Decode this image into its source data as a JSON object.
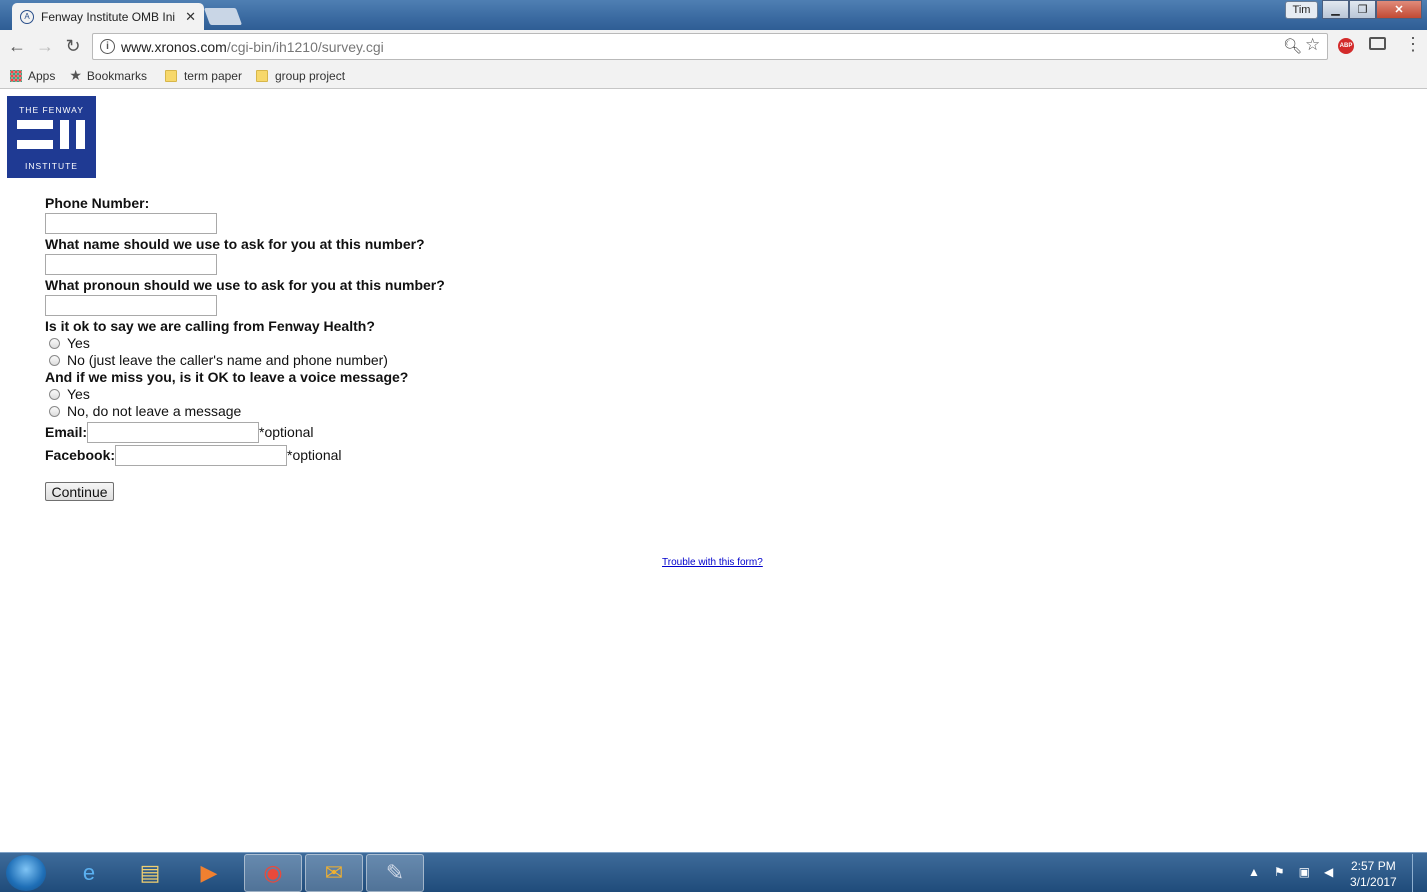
{
  "browser": {
    "tab_title": "Fenway Institute OMB Ini",
    "profile_name": "Tim",
    "url_host": "www.xronos.com",
    "url_path": "/cgi-bin/ih1210/survey.cgi",
    "bookmarks": [
      {
        "label": "Apps",
        "icon": "apps-grid-icon"
      },
      {
        "label": "Bookmarks",
        "icon": "star-icon"
      },
      {
        "label": "term paper",
        "icon": "folder-icon"
      },
      {
        "label": "group project",
        "icon": "folder-icon"
      }
    ]
  },
  "logo": {
    "line1": "THE FENWAY",
    "line2": "INSTITUTE",
    "color": "#1f3a93"
  },
  "form": {
    "phone_label": "Phone Number:",
    "name_label": "What name should we use to ask for you at this number?",
    "pronoun_label": "What pronoun should we use to ask for you at this number?",
    "fenway_label": "Is it ok to say we are calling from Fenway Health?",
    "fenway_yes": "Yes",
    "fenway_no": "No (just leave the caller's name and phone number)",
    "voicemail_label": "And if we miss you, is it OK to leave a voice message?",
    "voicemail_yes": "Yes",
    "voicemail_no": "No, do not leave a message",
    "email_label": "Email:",
    "email_note": "*optional",
    "facebook_label": "Facebook:",
    "facebook_note": "*optional",
    "continue_label": "Continue",
    "trouble_link": "Trouble with this form?"
  },
  "taskbar": {
    "time": "2:57 PM",
    "date": "3/1/2017"
  }
}
